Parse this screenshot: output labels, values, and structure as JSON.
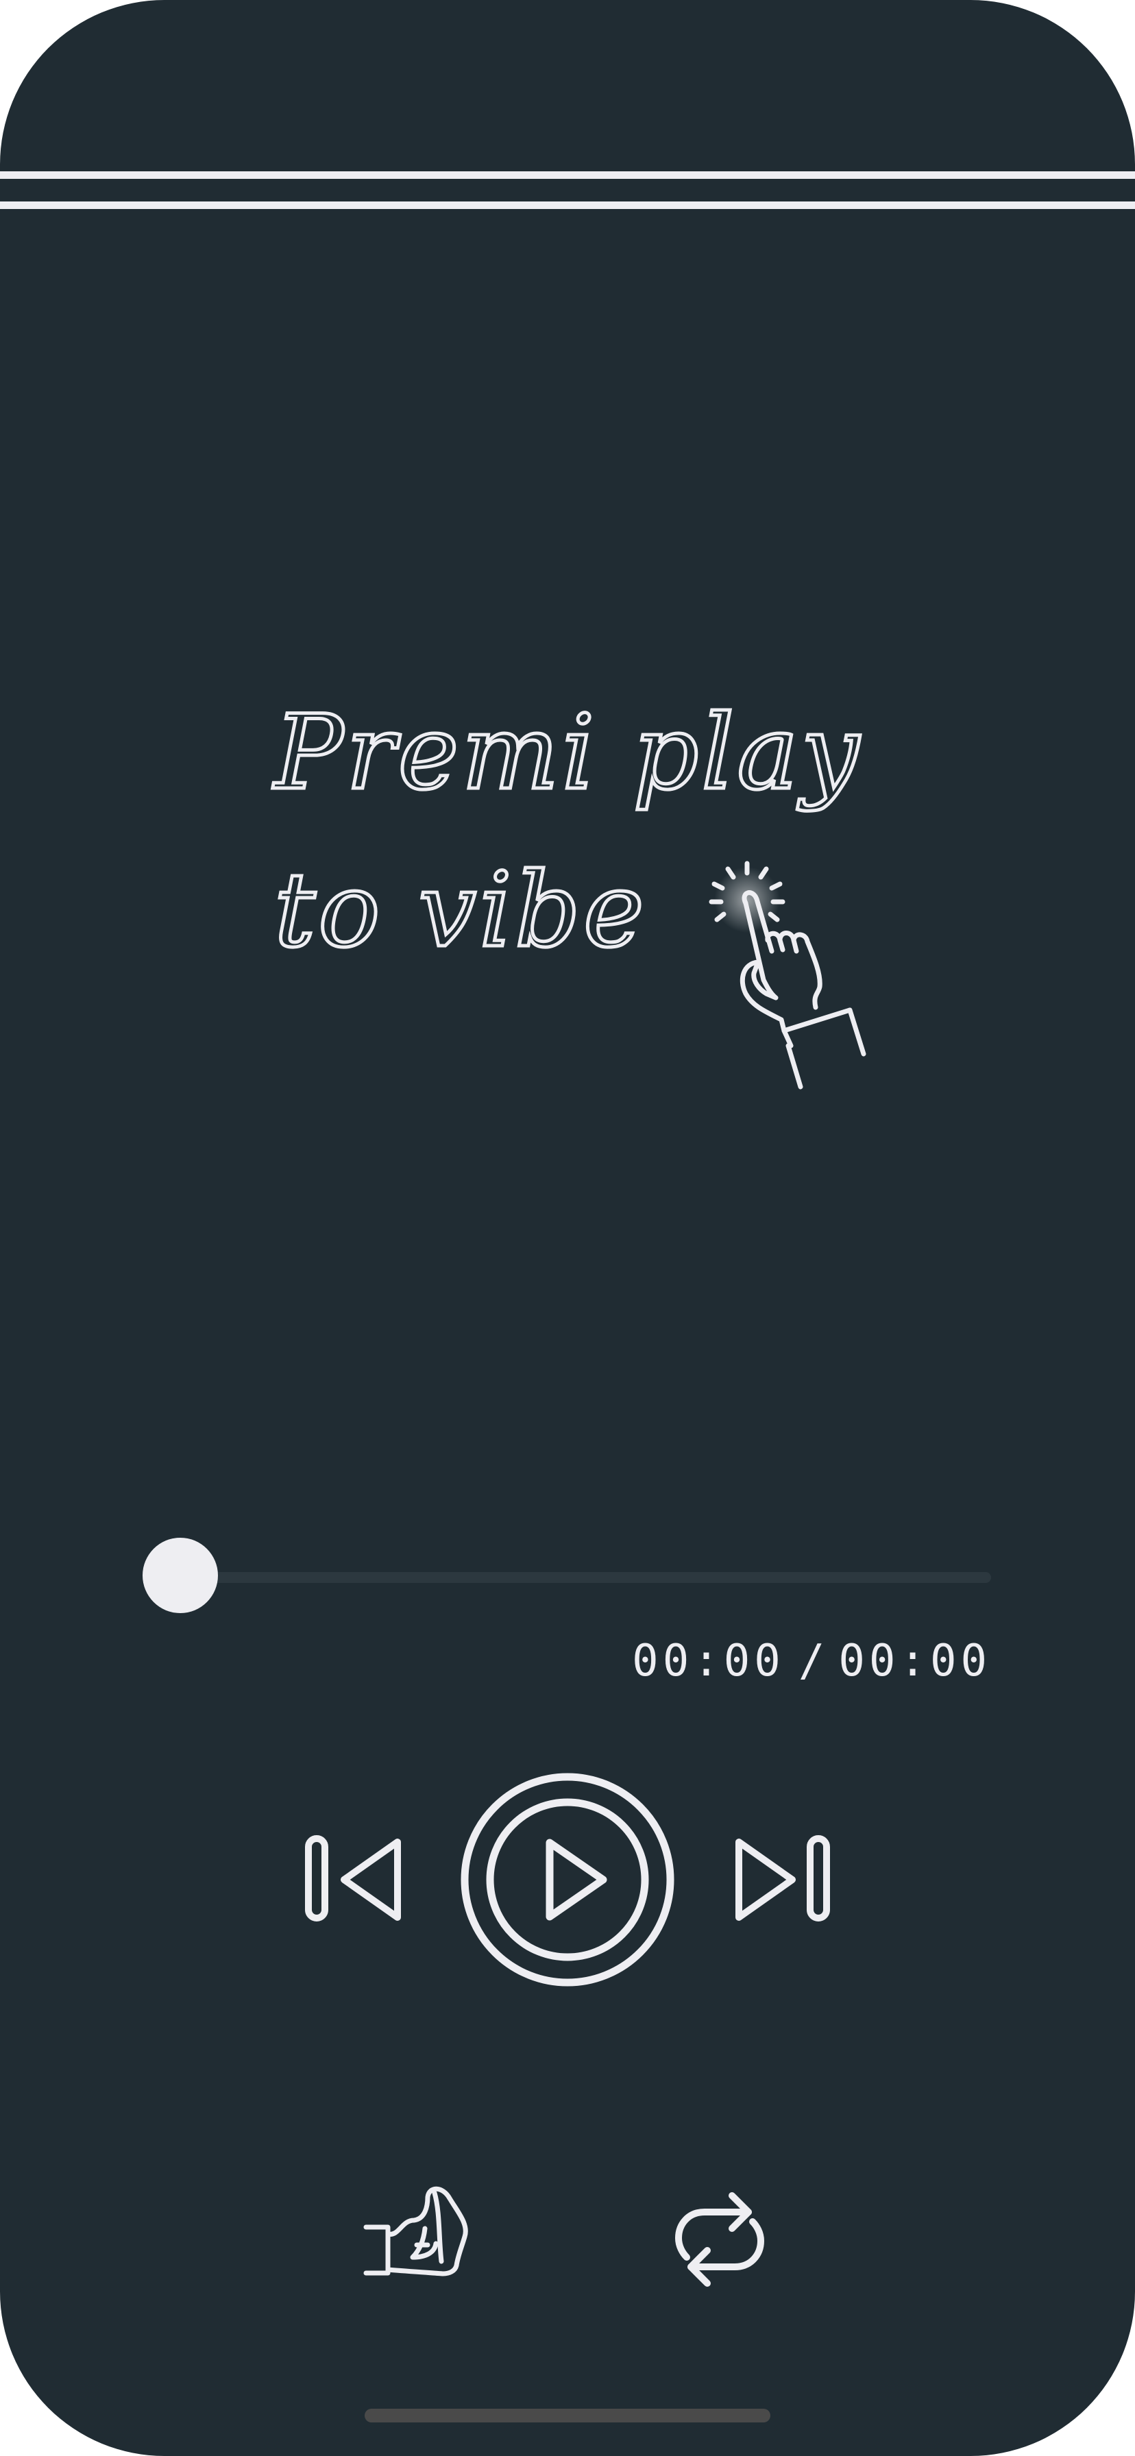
{
  "hint": {
    "line1": "Premi play",
    "line2": "to vibe",
    "pointer_icon": "tap-hand-icon"
  },
  "player": {
    "progress": 0,
    "current_time": "00:00",
    "separator": "/",
    "total_time": "00:00"
  },
  "controls": {
    "previous_icon": "skip-previous-icon",
    "play_icon": "play-circle-icon",
    "next_icon": "skip-next-icon",
    "like_icon": "thumbs-up-icon",
    "repeat_icon": "repeat-icon"
  },
  "colors": {
    "background": "#202c33",
    "foreground": "#eeeef2",
    "track": "#2c383f",
    "home_indicator": "#4a4a4a"
  }
}
